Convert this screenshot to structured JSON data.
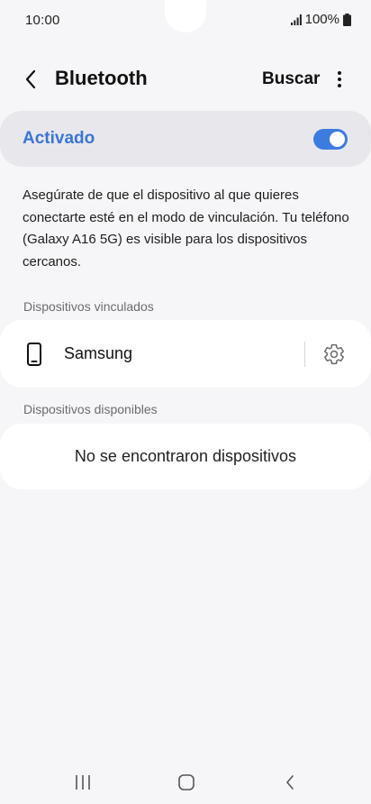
{
  "status_bar": {
    "time": "10:00",
    "battery": "100%",
    "icons": [
      "signal-icon",
      "battery-icon"
    ]
  },
  "header": {
    "title": "Bluetooth",
    "search_label": "Buscar",
    "icons": [
      "back-arrow-icon",
      "more-vert-icon"
    ]
  },
  "bluetooth_toggle": {
    "label": "Activado",
    "on": true,
    "accent_color": "#3e7be0"
  },
  "description": "Asegúrate de que el dispositivo al que quieres conectarte esté en el modo de vinculación. Tu teléfono (Galaxy A16 5G) es visible para los dispositivos cercanos.",
  "paired_devices": {
    "label": "Dispositivos vinculados",
    "items": [
      {
        "name": "Samsung",
        "icon": "phone-icon",
        "settings_icon": "gear-icon"
      }
    ]
  },
  "available_devices": {
    "label": "Dispositivos disponibles",
    "empty_text": "No se encontraron dispositivos"
  },
  "nav_bar": {
    "icons": [
      "recent-apps-icon",
      "home-icon",
      "nav-back-icon"
    ]
  }
}
